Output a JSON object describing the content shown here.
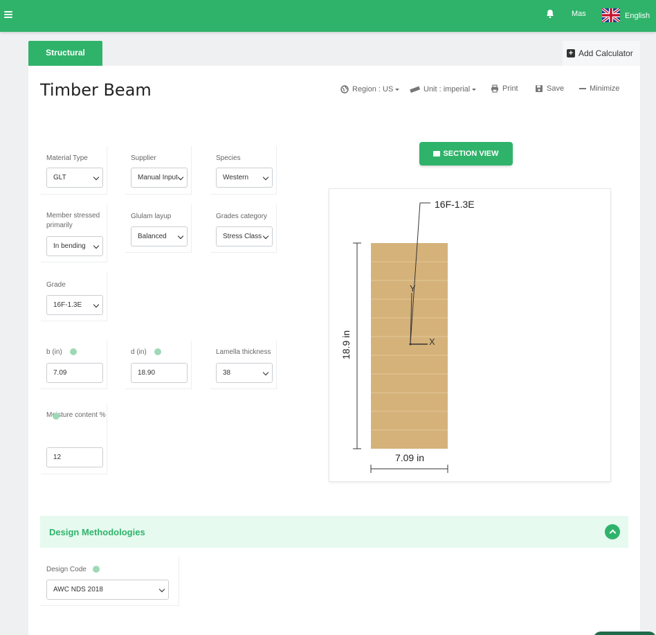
{
  "header": {
    "user_name": "Mas",
    "language": "English",
    "icons": [
      "menu-icon",
      "bell-icon",
      "uk-flag-icon"
    ]
  },
  "tabs": {
    "structural": "Structural",
    "add_calculator": "Add Calculator"
  },
  "page": {
    "title": "Timber Beam"
  },
  "toolbar": {
    "region": "Region : US",
    "unit": "Unit : imperial",
    "print": "Print",
    "save": "Save",
    "minimize": "Minimize"
  },
  "form": {
    "material_type": {
      "label": "Material Type",
      "value": "GLT"
    },
    "supplier": {
      "label": "Supplier",
      "value": "Manual Input"
    },
    "species": {
      "label": "Species",
      "value": "Western"
    },
    "member_stressed": {
      "label": "Member stressed primarily",
      "value": "In bending"
    },
    "glulam_layup": {
      "label": "Glulam layup",
      "value": "Balanced"
    },
    "grades_category": {
      "label": "Grades category",
      "value": "Stress Class"
    },
    "grade": {
      "label": "Grade",
      "value": "16F-1.3E"
    },
    "b": {
      "label": "b (in)",
      "value": "7.09"
    },
    "d": {
      "label": "d (in)",
      "value": "18.90"
    },
    "lamella_thickness": {
      "label": "Lamella thickness",
      "value": "38"
    },
    "moisture_content": {
      "label": "Moisture content %",
      "value": "12"
    }
  },
  "section_view": {
    "button_label": "SECTION VIEW",
    "grade_label": "16F-1.3E",
    "height_label": "18.9 in",
    "width_label": "7.09 in",
    "axis_x": "X",
    "axis_y": "Y",
    "lamella_count": 11,
    "wood_color": "#d5b27a"
  },
  "design": {
    "title": "Design Methodologies",
    "design_code_label": "Design Code",
    "design_code_value": "AWC NDS 2018"
  },
  "colors": {
    "brand_green": "#2fb36a",
    "light_green": "#e6faf0"
  }
}
